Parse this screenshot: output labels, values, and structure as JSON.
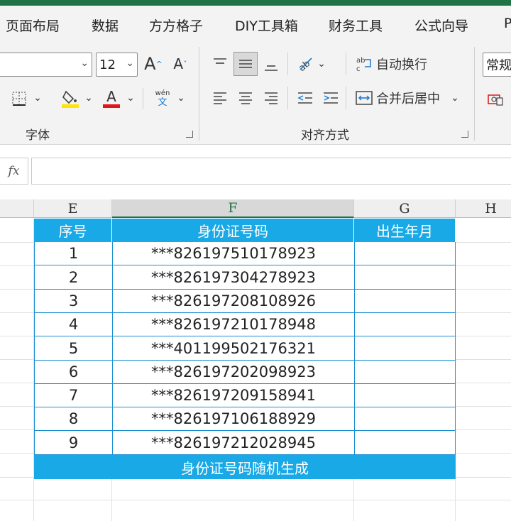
{
  "menu": [
    "页面布局",
    "数据",
    "方方格子",
    "DIY工具箱",
    "财务工具",
    "公式向导",
    "P"
  ],
  "font_group": {
    "font_size": "12",
    "label": "字体",
    "grow_icon": "A",
    "shrink_icon": "A",
    "font_color_icon": "A",
    "phonetic_top": "wén",
    "phonetic_bottom": "文"
  },
  "align_group": {
    "label": "对齐方式",
    "wrap_label": "自动换行",
    "merge_label": "合并后居中"
  },
  "number_group": {
    "format": "常规"
  },
  "formula_bar": {
    "fx": "fx",
    "value": ""
  },
  "columns": [
    "E",
    "F",
    "G",
    "H"
  ],
  "table": {
    "headers": [
      "序号",
      "身份证号码",
      "出生年月"
    ],
    "rows": [
      {
        "index": "1",
        "id": "***826197510178923",
        "birth": ""
      },
      {
        "index": "2",
        "id": "***826197304278923",
        "birth": ""
      },
      {
        "index": "3",
        "id": "***826197208108926",
        "birth": ""
      },
      {
        "index": "4",
        "id": "***826197210178948",
        "birth": ""
      },
      {
        "index": "5",
        "id": "***401199502176321",
        "birth": ""
      },
      {
        "index": "6",
        "id": "***826197202098923",
        "birth": ""
      },
      {
        "index": "7",
        "id": "***826197209158941",
        "birth": ""
      },
      {
        "index": "8",
        "id": "***826197106188929",
        "birth": ""
      },
      {
        "index": "9",
        "id": "***826197212028945",
        "birth": ""
      }
    ],
    "footer": "身份证号码随机生成"
  },
  "colors": {
    "header_fill": "#19a9e6",
    "table_border": "#1a8fd0",
    "excel_green": "#217346",
    "highlight_yellow": "#ffe600",
    "font_red": "#e0161b"
  }
}
